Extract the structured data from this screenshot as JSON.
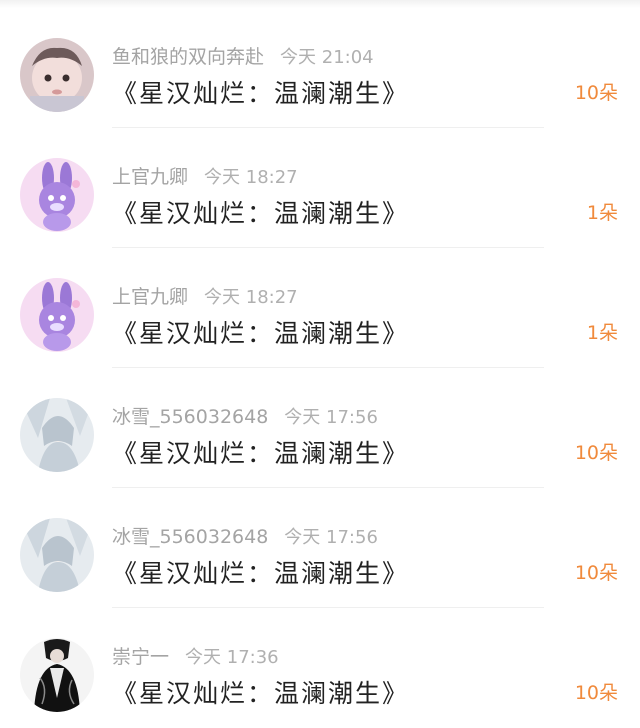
{
  "messages": [
    {
      "user": "鱼和狼的双向奔赴",
      "time": "今天 21:04",
      "title": "《星汉灿烂：温澜潮生》",
      "gift": "10朵",
      "avatar": "baby-avatar-icon"
    },
    {
      "user": "上官九卿",
      "time": "今天 18:27",
      "title": "《星汉灿烂：温澜潮生》",
      "gift": "1朵",
      "avatar": "bunny-avatar-icon"
    },
    {
      "user": "上官九卿",
      "time": "今天 18:27",
      "title": "《星汉灿烂：温澜潮生》",
      "gift": "1朵",
      "avatar": "bunny-avatar-icon"
    },
    {
      "user": "冰雪_556032648",
      "time": "今天 17:56",
      "title": "《星汉灿烂：温澜潮生》",
      "gift": "10朵",
      "avatar": "ice-figure-avatar-icon"
    },
    {
      "user": "冰雪_556032648",
      "time": "今天 17:56",
      "title": "《星汉灿烂：温澜潮生》",
      "gift": "10朵",
      "avatar": "ice-figure-avatar-icon"
    },
    {
      "user": "崇宁一",
      "time": "今天 17:36",
      "title": "《星汉灿烂：温澜潮生》",
      "gift": "10朵",
      "avatar": "dark-figure-avatar-icon"
    }
  ],
  "colors": {
    "username": "#a4a4a4",
    "title": "#222222",
    "gift": "#f08a3c",
    "divider": "#efefef"
  }
}
